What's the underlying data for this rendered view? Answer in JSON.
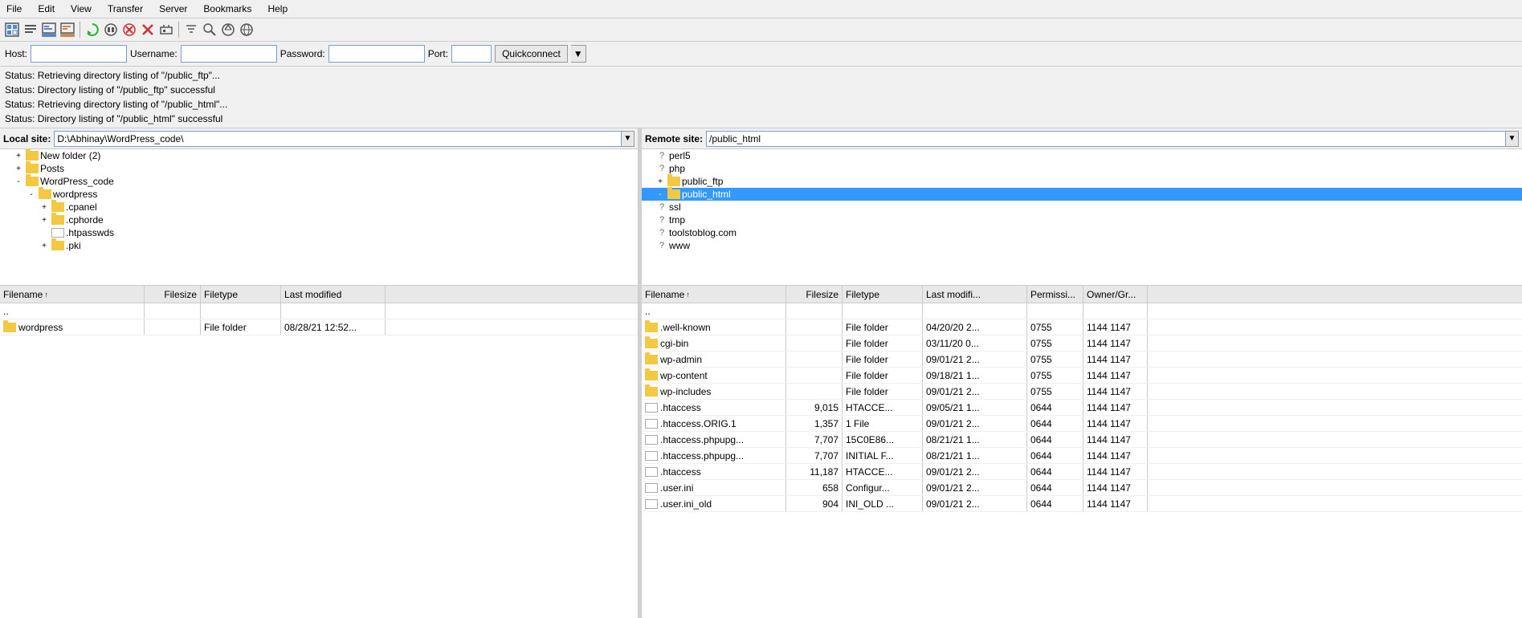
{
  "menu": {
    "items": [
      "File",
      "Edit",
      "View",
      "Transfer",
      "Server",
      "Bookmarks",
      "Help"
    ]
  },
  "toolbar": {
    "buttons": [
      {
        "name": "site-manager-icon",
        "symbol": "🖥"
      },
      {
        "name": "queue-icon",
        "symbol": "📋"
      },
      {
        "name": "log-icon",
        "symbol": "📄"
      },
      {
        "name": "message-log-icon",
        "symbol": "💬"
      },
      {
        "name": "refresh-icon",
        "symbol": "🔄"
      },
      {
        "name": "process-queue-icon",
        "symbol": "⚙"
      },
      {
        "name": "cancel-icon",
        "symbol": "🚫"
      },
      {
        "name": "cancel-all-icon",
        "symbol": "✖"
      },
      {
        "name": "reconnect-icon",
        "symbol": "🔌"
      },
      {
        "name": "filter-icon",
        "symbol": "🔀"
      },
      {
        "name": "find-icon",
        "symbol": "🔍"
      },
      {
        "name": "compare-icon",
        "symbol": "🔄"
      },
      {
        "name": "network-icon",
        "symbol": "🌐"
      }
    ]
  },
  "connection": {
    "host_label": "Host:",
    "host_value": "",
    "host_placeholder": "",
    "username_label": "Username:",
    "username_value": "",
    "password_label": "Password:",
    "password_value": "",
    "port_label": "Port:",
    "port_value": "",
    "quickconnect_label": "Quickconnect"
  },
  "status": {
    "lines": [
      "Status:     Retrieving directory listing of \"/public_ftp\"...",
      "Status:     Directory listing of \"/public_ftp\" successful",
      "Status:     Retrieving directory listing of \"/public_html\"...",
      "Status:     Directory listing of \"/public_html\" successful"
    ]
  },
  "local_pane": {
    "label": "Local site:",
    "path": "D:\\Abhinay\\WordPress_code\\",
    "tree": [
      {
        "indent": 1,
        "toggle": "+",
        "type": "folder",
        "label": "New folder (2)"
      },
      {
        "indent": 1,
        "toggle": "+",
        "type": "folder",
        "label": "Posts"
      },
      {
        "indent": 1,
        "toggle": "-",
        "type": "folder",
        "label": "WordPress_code"
      },
      {
        "indent": 2,
        "toggle": "-",
        "type": "folder",
        "label": "wordpress"
      },
      {
        "indent": 3,
        "toggle": "+",
        "type": "folder",
        "label": ".cpanel"
      },
      {
        "indent": 3,
        "toggle": "+",
        "type": "folder",
        "label": ".cphorde"
      },
      {
        "indent": 3,
        "toggle": " ",
        "type": "file",
        "label": ".htpasswds"
      },
      {
        "indent": 3,
        "toggle": "+",
        "type": "folder",
        "label": ".pki"
      }
    ],
    "file_columns": [
      "Filename",
      "Filesize",
      "Filetype",
      "Last modified"
    ],
    "files": [
      {
        "icon": "dotdot",
        "name": "..",
        "size": "",
        "type": "",
        "modified": ""
      },
      {
        "icon": "folder",
        "name": "wordpress",
        "size": "",
        "type": "File folder",
        "modified": "08/28/21 12:52..."
      }
    ]
  },
  "remote_pane": {
    "label": "Remote site:",
    "path": "/public_html",
    "tree": [
      {
        "indent": 1,
        "toggle": " ",
        "type": "question",
        "label": "perl5"
      },
      {
        "indent": 1,
        "toggle": " ",
        "type": "question",
        "label": "php"
      },
      {
        "indent": 1,
        "toggle": "+",
        "type": "folder",
        "label": "public_ftp"
      },
      {
        "indent": 1,
        "toggle": "-",
        "type": "folder",
        "label": "public_html",
        "selected": true
      },
      {
        "indent": 1,
        "toggle": " ",
        "type": "question",
        "label": "ssl"
      },
      {
        "indent": 1,
        "toggle": " ",
        "type": "question",
        "label": "tmp"
      },
      {
        "indent": 1,
        "toggle": " ",
        "type": "question",
        "label": "toolstoblog.com"
      },
      {
        "indent": 1,
        "toggle": " ",
        "type": "question",
        "label": "www"
      }
    ],
    "file_columns": [
      "Filename",
      "Filesize",
      "Filetype",
      "Last modifi...",
      "Permissi...",
      "Owner/Gr..."
    ],
    "files": [
      {
        "icon": "dotdot",
        "name": "..",
        "size": "",
        "type": "",
        "modified": "",
        "perms": "",
        "owner": ""
      },
      {
        "icon": "folder",
        "name": ".well-known",
        "size": "",
        "type": "File folder",
        "modified": "04/20/20 2...",
        "perms": "0755",
        "owner": "1144 1147"
      },
      {
        "icon": "folder",
        "name": "cgi-bin",
        "size": "",
        "type": "File folder",
        "modified": "03/11/20 0...",
        "perms": "0755",
        "owner": "1144 1147"
      },
      {
        "icon": "folder",
        "name": "wp-admin",
        "size": "",
        "type": "File folder",
        "modified": "09/01/21 2...",
        "perms": "0755",
        "owner": "1144 1147"
      },
      {
        "icon": "folder",
        "name": "wp-content",
        "size": "",
        "type": "File folder",
        "modified": "09/18/21 1...",
        "perms": "0755",
        "owner": "1144 1147"
      },
      {
        "icon": "folder",
        "name": "wp-includes",
        "size": "",
        "type": "File folder",
        "modified": "09/01/21 2...",
        "perms": "0755",
        "owner": "1144 1147"
      },
      {
        "icon": "generic",
        "name": ".htaccess",
        "size": "9,015",
        "type": "HTACCE...",
        "modified": "09/05/21 1...",
        "perms": "0644",
        "owner": "1144 1147"
      },
      {
        "icon": "generic",
        "name": ".htaccess.ORIG.1",
        "size": "1,357",
        "type": "1 File",
        "modified": "09/01/21 2...",
        "perms": "0644",
        "owner": "1144 1147"
      },
      {
        "icon": "generic",
        "name": ".htaccess.phpupg...",
        "size": "7,707",
        "type": "15C0E86...",
        "modified": "08/21/21 1...",
        "perms": "0644",
        "owner": "1144 1147"
      },
      {
        "icon": "generic",
        "name": ".htaccess.phpupg...",
        "size": "7,707",
        "type": "INITIAL F...",
        "modified": "08/21/21 1...",
        "perms": "0644",
        "owner": "1144 1147"
      },
      {
        "icon": "generic",
        "name": ".htaccess",
        "size": "11,187",
        "type": "HTACCE...",
        "modified": "09/01/21 2...",
        "perms": "0644",
        "owner": "1144 1147"
      },
      {
        "icon": "config",
        "name": ".user.ini",
        "size": "658",
        "type": "Configur...",
        "modified": "09/01/21 2...",
        "perms": "0644",
        "owner": "1144 1147"
      },
      {
        "icon": "generic",
        "name": ".user.ini_old",
        "size": "904",
        "type": "INI_OLD ...",
        "modified": "09/01/21 2...",
        "perms": "0644",
        "owner": "1144 1147"
      }
    ]
  }
}
